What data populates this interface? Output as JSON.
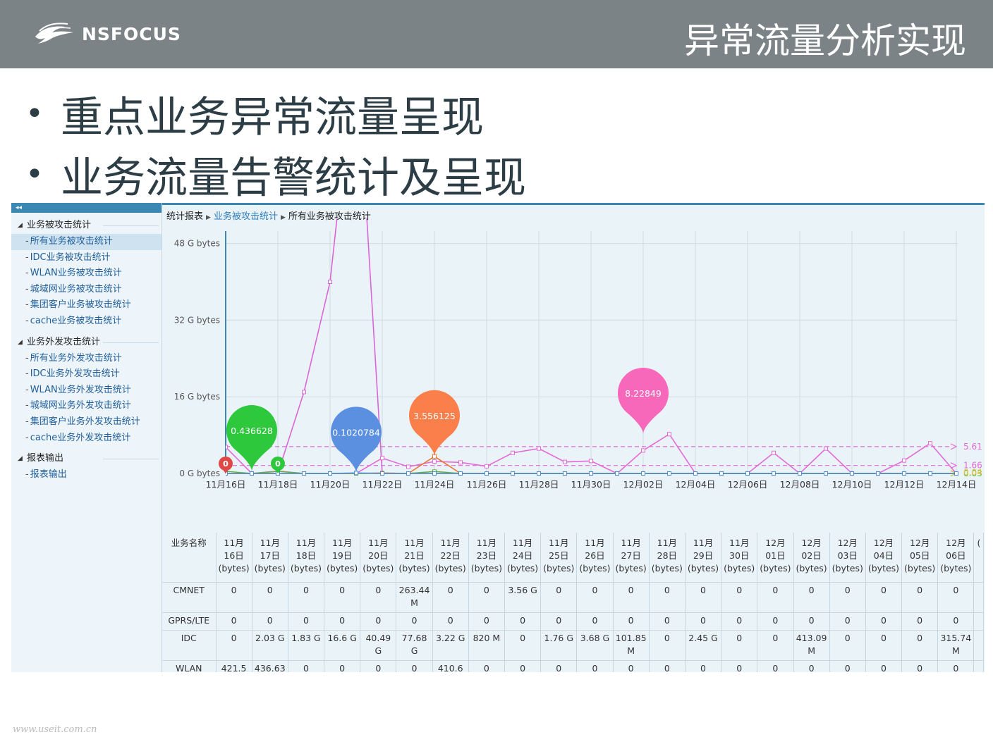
{
  "header": {
    "logo_text": "NSFOCUS",
    "title": "异常流量分析实现"
  },
  "bullets": [
    "重点业务异常流量呈现",
    "业务流量告警统计及呈现"
  ],
  "sidebar": {
    "toggle": "◂◂",
    "groups": [
      {
        "label": "业务被攻击统计",
        "items": [
          "所有业务被攻击统计",
          "IDC业务被攻击统计",
          "WLAN业务被攻击统计",
          "城域网业务被攻击统计",
          "集团客户业务被攻击统计",
          "cache业务被攻击统计"
        ]
      },
      {
        "label": "业务外发攻击统计",
        "items": [
          "所有业务外发攻击统计",
          "IDC业务外发攻击统计",
          "WLAN业务外发攻击统计",
          "城域网业务外发攻击统计",
          "集团客户业务外发攻击统计",
          "cache业务外发攻击统计"
        ]
      },
      {
        "label": "报表输出",
        "items": [
          "报表输出"
        ]
      }
    ]
  },
  "breadcrumb": {
    "root": "统计报表",
    "section": "业务被攻击统计",
    "current": "所有业务被攻击统计"
  },
  "chart_data": {
    "type": "line",
    "y_ticks": [
      "48 G bytes",
      "32 G bytes",
      "16 G bytes",
      "0 G bytes"
    ],
    "y_tick_values": [
      48,
      32,
      16,
      0
    ],
    "ylim": [
      0,
      48
    ],
    "x_ticks": [
      "11月16日",
      "11月18日",
      "11月20日",
      "11月22日",
      "11月24日",
      "11月26日",
      "11月28日",
      "11月30日",
      "12月02日",
      "12月04日",
      "12月06日",
      "12月08日",
      "12月10日",
      "12月12日",
      "12月14日"
    ],
    "grid": true,
    "series": [
      {
        "color": "#d966d6",
        "values": [
          0,
          0,
          0,
          17,
          40,
          90,
          0,
          0,
          0,
          0,
          0,
          0,
          0,
          0,
          0,
          0,
          0,
          0,
          0,
          0,
          0,
          0,
          0,
          0,
          0,
          0,
          0,
          0,
          0
        ]
      },
      {
        "color": "#e36ad8",
        "values": [
          5.5,
          0,
          0.5,
          0,
          0,
          0,
          3.2,
          1.4,
          2.5,
          2.3,
          1.5,
          4.3,
          5.2,
          2.4,
          2.6,
          0,
          4.8,
          8.2,
          0,
          0,
          0,
          4.3,
          0,
          5.2,
          0,
          0,
          2.7,
          6.3,
          0
        ]
      },
      {
        "color": "#e8772e",
        "values": [
          0,
          0,
          0,
          0,
          0,
          0,
          0.1,
          0,
          3.56,
          0,
          0,
          0,
          0,
          0,
          0,
          0,
          0,
          0,
          0,
          0,
          0,
          0,
          0,
          0,
          0,
          0,
          0,
          0,
          0
        ]
      },
      {
        "color": "#5fb834",
        "values": [
          0.44,
          0,
          0.44,
          0,
          0,
          0,
          0,
          0,
          0.41,
          0,
          0,
          0,
          0,
          0,
          0,
          0,
          0,
          0,
          0,
          0,
          0,
          0,
          0,
          0,
          0,
          0,
          0,
          0,
          0
        ]
      },
      {
        "color": "#4b8bd8",
        "values": [
          0,
          0,
          0,
          0,
          0,
          0.1,
          0,
          0,
          0,
          0,
          0,
          0,
          0,
          0,
          0,
          0,
          0,
          0,
          0,
          0,
          0,
          0,
          0,
          0,
          0,
          0,
          0,
          0,
          0
        ]
      }
    ],
    "avg_lines": [
      {
        "label": "5.61",
        "value": 5.61,
        "color": "#e36ad8"
      },
      {
        "label": "1.66",
        "value": 1.66,
        "color": "#e36ad8"
      },
      {
        "label": "0.03",
        "value": 0.03,
        "color": "#5fb834"
      },
      {
        "label": "0.04",
        "value": 0.04,
        "color": "#e8c23a"
      }
    ],
    "balloons": [
      {
        "label": "0.436628",
        "color": "#2ec83d",
        "day_index": 1,
        "value": 0.44
      },
      {
        "label": "0.1020784",
        "color": "#5b8fe0",
        "day_index": 5,
        "value": 0.1
      },
      {
        "label": "3.556125",
        "color": "#fb7f4a",
        "day_index": 8,
        "value": 3.56
      },
      {
        "label": "8.22849",
        "color": "#f768ba",
        "day_index": 16,
        "value": 8.23
      }
    ],
    "small_markers": [
      {
        "label": "0",
        "color": "#e04848",
        "day_index": 0
      },
      {
        "label": "0",
        "color": "#2ec83d",
        "day_index": 2
      }
    ]
  },
  "table": {
    "name_header": "业务名称",
    "columns": [
      [
        "11月",
        "16日",
        "(bytes)"
      ],
      [
        "11月",
        "17日",
        "(bytes)"
      ],
      [
        "11月",
        "18日",
        "(bytes)"
      ],
      [
        "11月",
        "19日",
        "(bytes)"
      ],
      [
        "11月",
        "20日",
        "(bytes)"
      ],
      [
        "11月",
        "21日",
        "(bytes)"
      ],
      [
        "11月",
        "22日",
        "(bytes)"
      ],
      [
        "11月",
        "23日",
        "(bytes)"
      ],
      [
        "11月",
        "24日",
        "(bytes)"
      ],
      [
        "11月",
        "25日",
        "(bytes)"
      ],
      [
        "11月",
        "26日",
        "(bytes)"
      ],
      [
        "11月",
        "27日",
        "(bytes)"
      ],
      [
        "11月",
        "28日",
        "(bytes)"
      ],
      [
        "11月",
        "29日",
        "(bytes)"
      ],
      [
        "11月",
        "30日",
        "(bytes)"
      ],
      [
        "12月",
        "01日",
        "(bytes)"
      ],
      [
        "12月",
        "02日",
        "(bytes)"
      ],
      [
        "12月",
        "03日",
        "(bytes)"
      ],
      [
        "12月",
        "04日",
        "(bytes)"
      ],
      [
        "12月",
        "05日",
        "(bytes)"
      ],
      [
        "12月",
        "06日",
        "(bytes)"
      ],
      [
        "(",
        "",
        ""
      ]
    ],
    "rows": [
      {
        "name": "CMNET",
        "cells": [
          "0",
          "0",
          "0",
          "0",
          "0",
          "263.44 M",
          "0",
          "0",
          "3.56 G",
          "0",
          "0",
          "0",
          "0",
          "0",
          "0",
          "0",
          "0",
          "0",
          "0",
          "0",
          "0",
          ""
        ]
      },
      {
        "name": "GPRS/LTE",
        "cells": [
          "0",
          "0",
          "0",
          "0",
          "0",
          "0",
          "0",
          "0",
          "0",
          "0",
          "0",
          "0",
          "0",
          "0",
          "0",
          "0",
          "0",
          "0",
          "0",
          "0",
          "0",
          ""
        ]
      },
      {
        "name": "IDC",
        "cells": [
          "0",
          "2.03 G",
          "1.83 G",
          "16.6 G",
          "40.49 G",
          "77.68 G",
          "3.22 G",
          "820 M",
          "0",
          "1.76 G",
          "3.68 G",
          "101.85 M",
          "0",
          "2.45 G",
          "0",
          "0",
          "413.09 M",
          "0",
          "0",
          "0",
          "315.74 M",
          ""
        ]
      },
      {
        "name": "WLAN",
        "cells": [
          "421.5",
          "436.63",
          "0",
          "0",
          "0",
          "0",
          "410.6",
          "0",
          "0",
          "0",
          "0",
          "0",
          "0",
          "0",
          "0",
          "0",
          "0",
          "0",
          "0",
          "0",
          "0",
          ""
        ]
      }
    ]
  },
  "watermark": "www.useit.com.cn"
}
